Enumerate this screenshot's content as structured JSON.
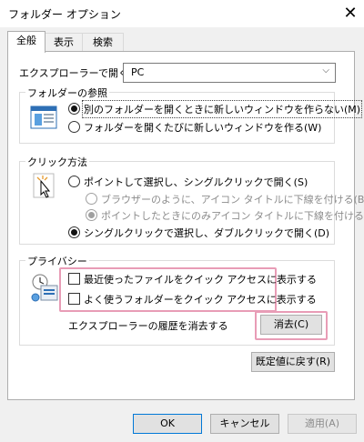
{
  "window": {
    "title": "フォルダー オプション",
    "close_glyph": "✕"
  },
  "tabs": [
    {
      "label": "全般",
      "active": true
    },
    {
      "label": "表示",
      "active": false
    },
    {
      "label": "検索",
      "active": false
    }
  ],
  "open_explorer": {
    "label": "エクスプローラーで開く:",
    "value": "PC",
    "caret": "⌵"
  },
  "browse_folders": {
    "legend": "フォルダーの参照",
    "options": [
      {
        "label": "別のフォルダーを開くときに新しいウィンドウを作らない(M)",
        "selected": true
      },
      {
        "label": "フォルダーを開くたびに新しいウィンドウを作る(W)",
        "selected": false
      }
    ]
  },
  "click_items": {
    "legend": "クリック方法",
    "options": [
      {
        "label": "ポイントして選択し、シングルクリックで開く(S)",
        "selected": false,
        "disabled": false
      },
      {
        "label": "ブラウザーのように、アイコン タイトルに下線を付ける(B)",
        "selected": false,
        "disabled": true
      },
      {
        "label": "ポイントしたときにのみアイコン タイトルに下線を付ける(P)",
        "selected": true,
        "disabled": true
      },
      {
        "label": "シングルクリックで選択し、ダブルクリックで開く(D)",
        "selected": true,
        "disabled": false
      }
    ]
  },
  "privacy": {
    "legend": "プライバシー",
    "checkboxes": [
      {
        "label": "最近使ったファイルをクイック アクセスに表示する",
        "checked": false
      },
      {
        "label": "よく使うフォルダーをクイック アクセスに表示する",
        "checked": false
      }
    ],
    "clear_history_label": "エクスプローラーの履歴を消去する",
    "clear_button": "消去(C)"
  },
  "restore_defaults_button": "既定値に戻す(R)",
  "footer": {
    "ok": "OK",
    "cancel": "キャンセル",
    "apply": "適用(A)"
  },
  "colors": {
    "highlight": "#e89cb6",
    "accent": "#0078d7"
  }
}
